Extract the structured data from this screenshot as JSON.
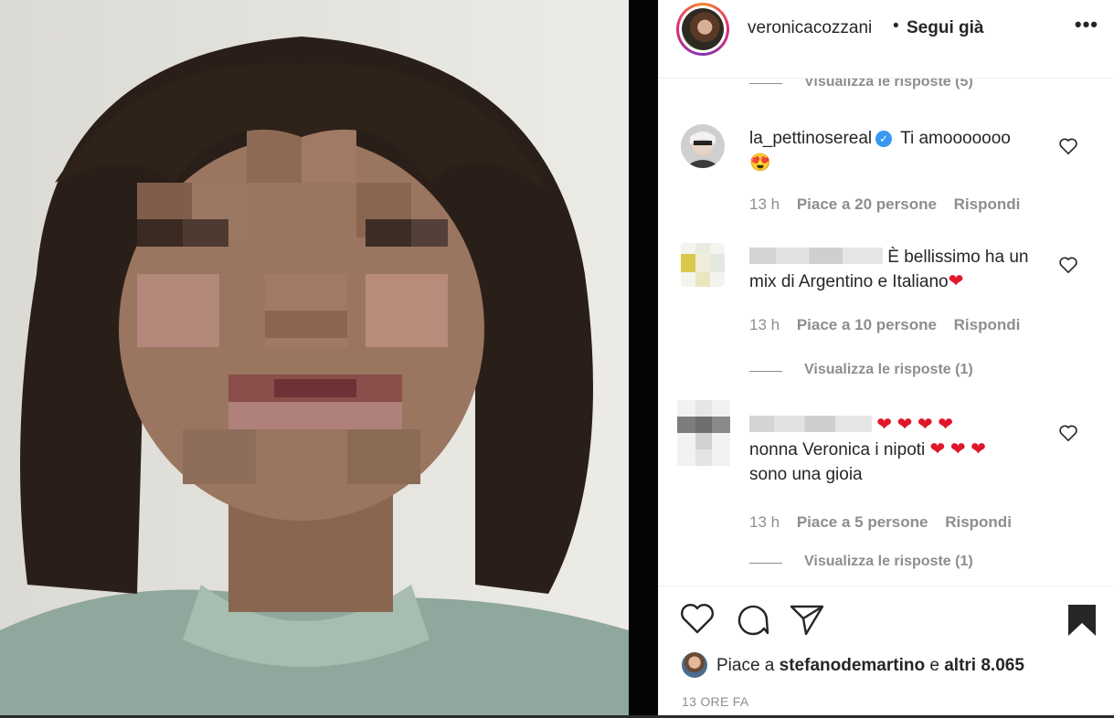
{
  "header": {
    "username": "veronicacozzani",
    "separator": "•",
    "follow_status": "Segui già",
    "more_icon": "more-horizontal-icon"
  },
  "comments": [
    {
      "replies_label": "Visualizza le risposte (5)"
    },
    {
      "user": "la_pettinosereal",
      "verified": true,
      "text": "Ti amooooooo",
      "emoji": "😍",
      "time": "13 h",
      "likes": "Piace a 20 persone",
      "reply": "Rispondi"
    },
    {
      "user_blurred": true,
      "text": "È bellissimo ha un mix di Argentino e Italiano",
      "emoji": "❤",
      "time": "13 h",
      "likes": "Piace a 10 persone",
      "reply": "Rispondi",
      "replies_label": "Visualizza le risposte (1)"
    },
    {
      "user_blurred": true,
      "text_prefix_emoji": "❤ ❤ ❤ ❤",
      "text": "nonna Veronica i nipoti",
      "text_emoji": "❤ ❤ ❤",
      "text_end": "sono una gioia",
      "time": "13 h",
      "likes": "Piace a 5 persone",
      "reply": "Rispondi",
      "replies_label": "Visualizza le risposte (1)"
    }
  ],
  "actions": {
    "likes_prefix": "Piace a",
    "liked_by": "stefanodemartino",
    "likes_connector": "e",
    "likes_others": "altri 8.065",
    "timestamp": "13 ORE FA"
  },
  "colors": {
    "text": "#262626",
    "secondary": "#8e8e8e",
    "verified": "#3897f0",
    "heart": "#e0162b"
  }
}
